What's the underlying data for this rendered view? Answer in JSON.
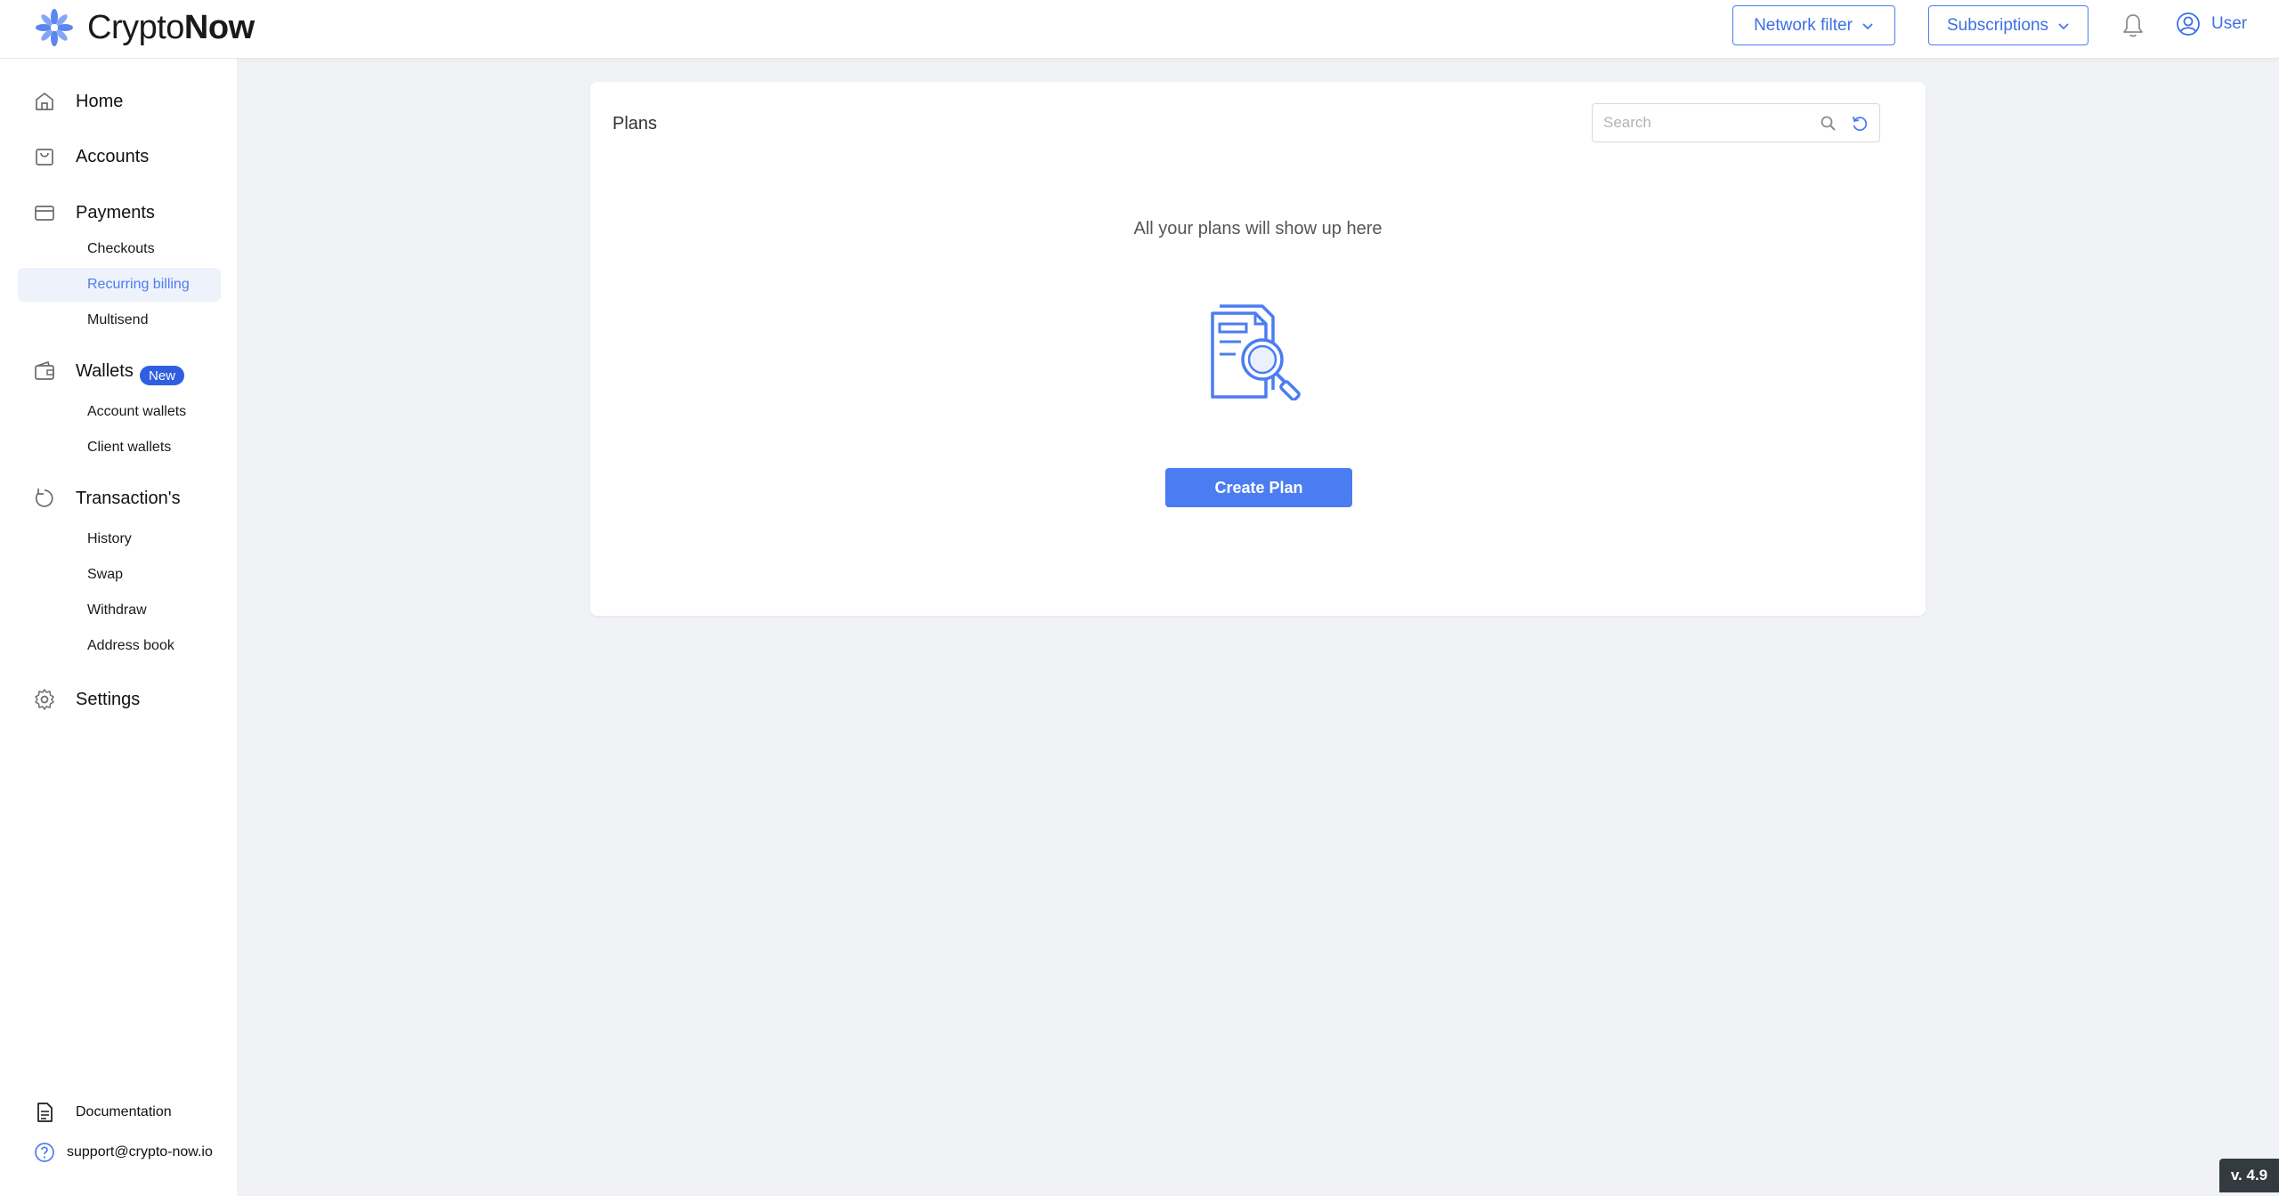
{
  "brand": {
    "name_light": "Crypto",
    "name_bold": "Now",
    "accent": "#4c7cf2",
    "badge_color": "#2f5fe0"
  },
  "header": {
    "network_filter": "Network filter",
    "subscriptions": "Subscriptions",
    "user": "User",
    "bell_icon": "bell-icon"
  },
  "sidebar": {
    "home": "Home",
    "accounts": "Accounts",
    "payments": "Payments",
    "payments_items": [
      "Checkouts",
      "Recurring billing",
      "Multisend"
    ],
    "active_item": "Recurring billing",
    "wallets": "Wallets",
    "wallets_badge": "New",
    "wallets_items": [
      "Account wallets",
      "Client wallets"
    ],
    "transactions": "Transaction's",
    "transactions_items": [
      "History",
      "Swap",
      "Withdraw",
      "Address book"
    ],
    "settings": "Settings",
    "documentation": "Documentation",
    "support_email": "support@crypto-now.io"
  },
  "main": {
    "title": "Plans",
    "search_placeholder": "Search",
    "empty_message": "All your plans will show up here",
    "create_button": "Create Plan"
  },
  "version": "v. 4.9"
}
